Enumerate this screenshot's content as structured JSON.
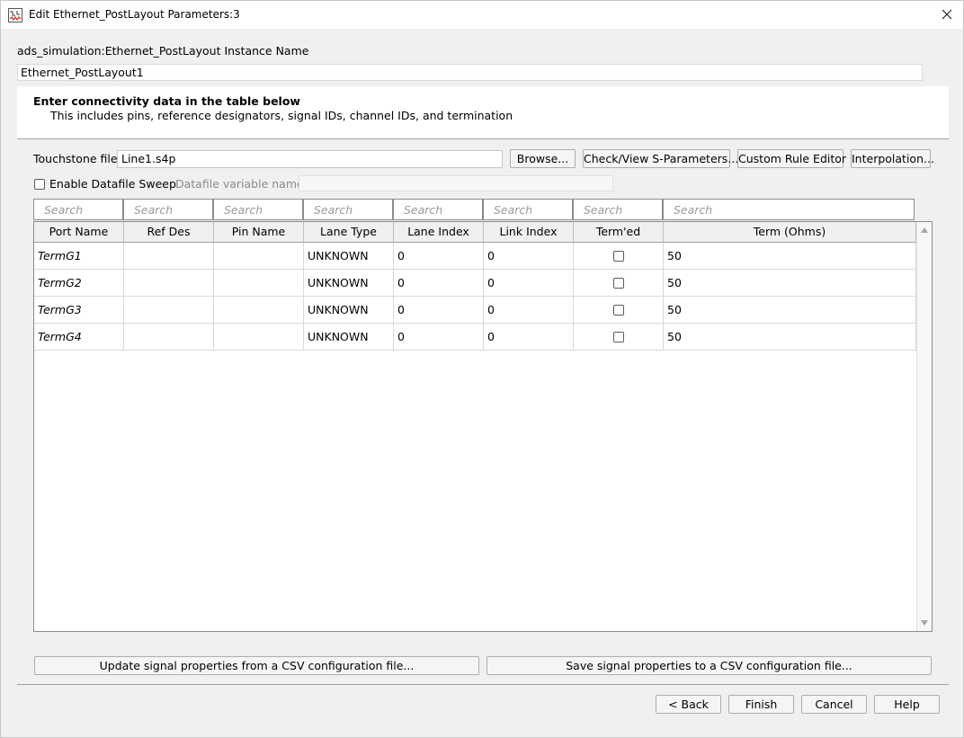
{
  "window": {
    "title": "Edit Ethernet_PostLayout Parameters:3",
    "close_icon": "close-icon"
  },
  "instance": {
    "label": "ads_simulation:Ethernet_PostLayout Instance Name",
    "value": "Ethernet_PostLayout1"
  },
  "info": {
    "title": "Enter connectivity data in the table below",
    "subtitle": "This includes pins, reference designators, signal IDs, channel IDs, and termination"
  },
  "touchstone": {
    "label": "Touchstone file",
    "value": "Line1.s4p",
    "browse_label": "Browse...",
    "check_view_label": "Check/View S-Parameters...",
    "custom_rule_label": "Custom Rule Editor",
    "interpolation_label": "Interpolation..."
  },
  "sweep": {
    "enable_label": "Enable Datafile Sweep",
    "variable_label": "Datafile variable name",
    "variable_value": ""
  },
  "table": {
    "search_placeholder": "Search",
    "columns": [
      "Port Name",
      "Ref Des",
      "Pin Name",
      "Lane Type",
      "Lane Index",
      "Link Index",
      "Term'ed",
      "Term (Ohms)"
    ],
    "rows": [
      {
        "port": "TermG1",
        "ref_des": "",
        "pin": "",
        "lane_type": "UNKNOWN",
        "lane_index": "0",
        "link_index": "0",
        "termed": false,
        "term": "50"
      },
      {
        "port": "TermG2",
        "ref_des": "",
        "pin": "",
        "lane_type": "UNKNOWN",
        "lane_index": "0",
        "link_index": "0",
        "termed": false,
        "term": "50"
      },
      {
        "port": "TermG3",
        "ref_des": "",
        "pin": "",
        "lane_type": "UNKNOWN",
        "lane_index": "0",
        "link_index": "0",
        "termed": false,
        "term": "50"
      },
      {
        "port": "TermG4",
        "ref_des": "",
        "pin": "",
        "lane_type": "UNKNOWN",
        "lane_index": "0",
        "link_index": "0",
        "termed": false,
        "term": "50"
      }
    ]
  },
  "csv": {
    "update_label": "Update signal properties from a CSV configuration file...",
    "save_label": "Save signal properties to a CSV configuration file..."
  },
  "footer": {
    "back_label": "< Back",
    "finish_label": "Finish",
    "cancel_label": "Cancel",
    "help_label": "Help"
  }
}
